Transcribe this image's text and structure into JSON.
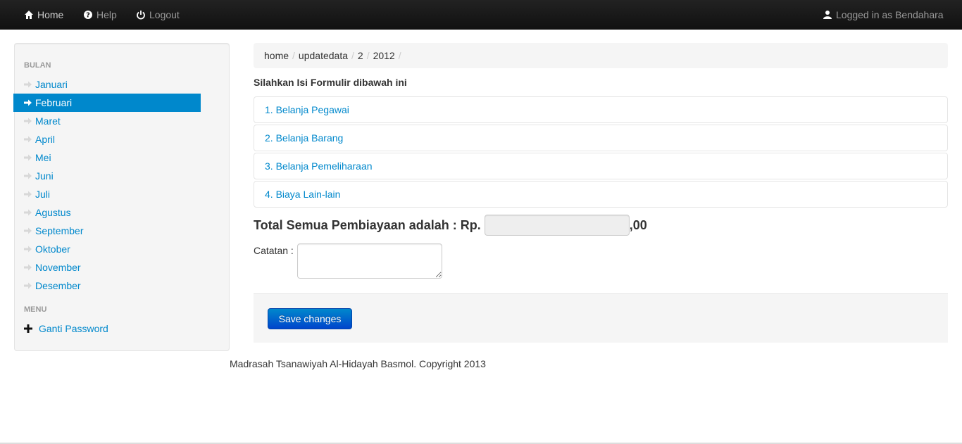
{
  "navbar": {
    "home_label": "Home",
    "help_label": "Help",
    "logout_label": "Logout",
    "user_label": "Logged in as Bendahara"
  },
  "sidebar": {
    "bulan_header": "BULAN",
    "months": [
      {
        "label": "Januari",
        "active": false
      },
      {
        "label": "Februari",
        "active": true
      },
      {
        "label": "Maret",
        "active": false
      },
      {
        "label": "April",
        "active": false
      },
      {
        "label": "Mei",
        "active": false
      },
      {
        "label": "Juni",
        "active": false
      },
      {
        "label": "Juli",
        "active": false
      },
      {
        "label": "Agustus",
        "active": false
      },
      {
        "label": "September",
        "active": false
      },
      {
        "label": "Oktober",
        "active": false
      },
      {
        "label": "November",
        "active": false
      },
      {
        "label": "Desember",
        "active": false
      }
    ],
    "menu_header": "MENU",
    "menu_item": "Ganti Password"
  },
  "breadcrumb": [
    "home",
    "updatedata",
    "2",
    "2012"
  ],
  "main": {
    "form_title": "Silahkan Isi Formulir dibawah ini",
    "sections": [
      "1. Belanja Pegawai",
      "2. Belanja Barang",
      "3. Belanja Pemeliharaan",
      "4. Biaya Lain-lain"
    ],
    "total_label": "Total Semua Pembiayaan adalah : Rp.",
    "total_value": "",
    "total_suffix": ",00",
    "catatan_label": "Catatan :",
    "catatan_value": "",
    "save_label": "Save changes"
  },
  "footer": "Madrasah Tsanawiyah Al-Hidayah Basmol. Copyright 2013",
  "colors": {
    "link": "#0088cc",
    "active_bg": "#0088cc",
    "navbar_bg": "#1b1b1b"
  }
}
